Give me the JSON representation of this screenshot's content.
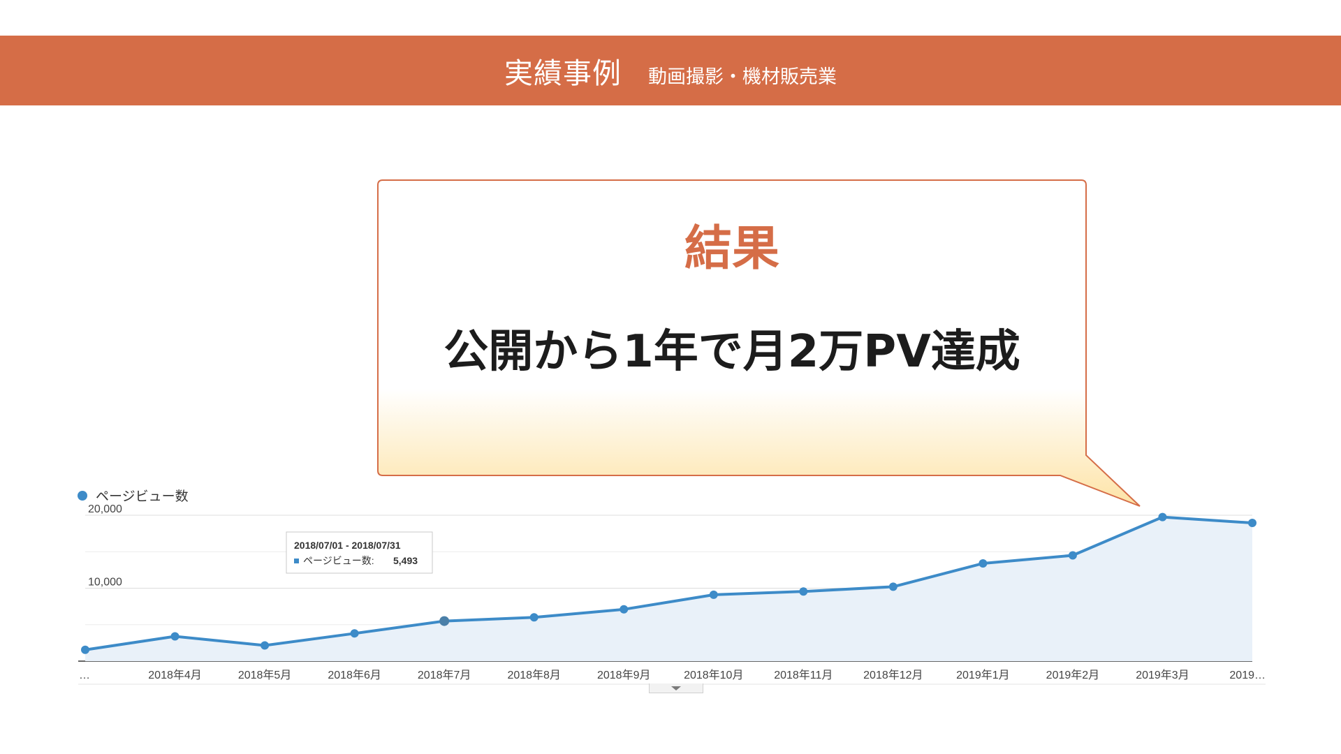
{
  "header": {
    "title": "実績事例",
    "subtitle": "動画撮影・機材販売業"
  },
  "callout": {
    "label": "結果",
    "text": "公開から1年で月2万PV達成"
  },
  "colors": {
    "header_bg": "#d56d47",
    "accent": "#d56d47",
    "series": "#3d8bc8",
    "area_fill": "#e9f1f9"
  },
  "chart_data": {
    "type": "area",
    "legend": "ページビュー数",
    "legend_position": "top-left",
    "grid": true,
    "ylim": [
      0,
      20000
    ],
    "ytick_labels": [
      "20,000",
      "10,000"
    ],
    "x_labels": [
      "…",
      "2018年4月",
      "2018年5月",
      "2018年6月",
      "2018年7月",
      "2018年8月",
      "2018年9月",
      "2018年10月",
      "2018年11月",
      "2018年12月",
      "2019年1月",
      "2019年2月",
      "2019年3月",
      "2019…"
    ],
    "series": [
      {
        "name": "ページビュー数",
        "values": [
          1550,
          3400,
          2150,
          3800,
          5493,
          6000,
          7100,
          9100,
          9550,
          10200,
          13400,
          14500,
          19750,
          18950
        ]
      }
    ],
    "tooltip": {
      "date_range": "2018/07/01 - 2018/07/31",
      "label": "ページビュー数:",
      "value": "5,493"
    }
  }
}
